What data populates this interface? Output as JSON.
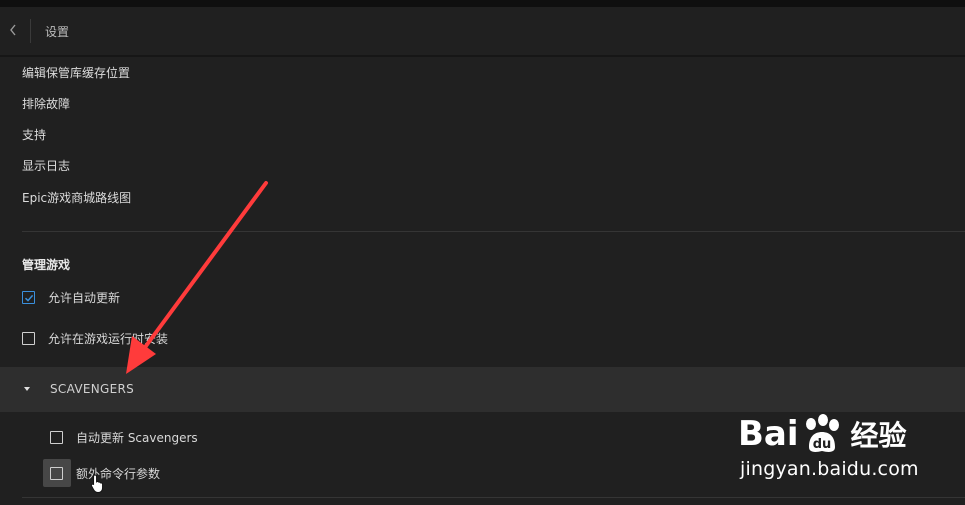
{
  "header": {
    "title": "设置"
  },
  "links": [
    "编辑保管库缓存位置",
    "排除故障",
    "支持",
    "显示日志",
    "Epic游戏商城路线图"
  ],
  "manage_games": {
    "title": "管理游戏",
    "options": [
      {
        "label": "允许自动更新",
        "checked": true
      },
      {
        "label": "允许在游戏运行时安装",
        "checked": false
      }
    ]
  },
  "game": {
    "name": "SCAVENGERS",
    "options": [
      {
        "label": "自动更新 Scavengers",
        "checked": false
      },
      {
        "label": "额外命令行参数",
        "checked": false
      }
    ]
  },
  "watermark": {
    "logo_left": "Bai",
    "logo_right": "经验",
    "url": "jingyan.baidu.com"
  },
  "colors": {
    "background": "#202020",
    "accent_check": "#3a8fdc",
    "annotation_arrow": "#ff3b3b",
    "game_bar": "#2e2e2e"
  }
}
